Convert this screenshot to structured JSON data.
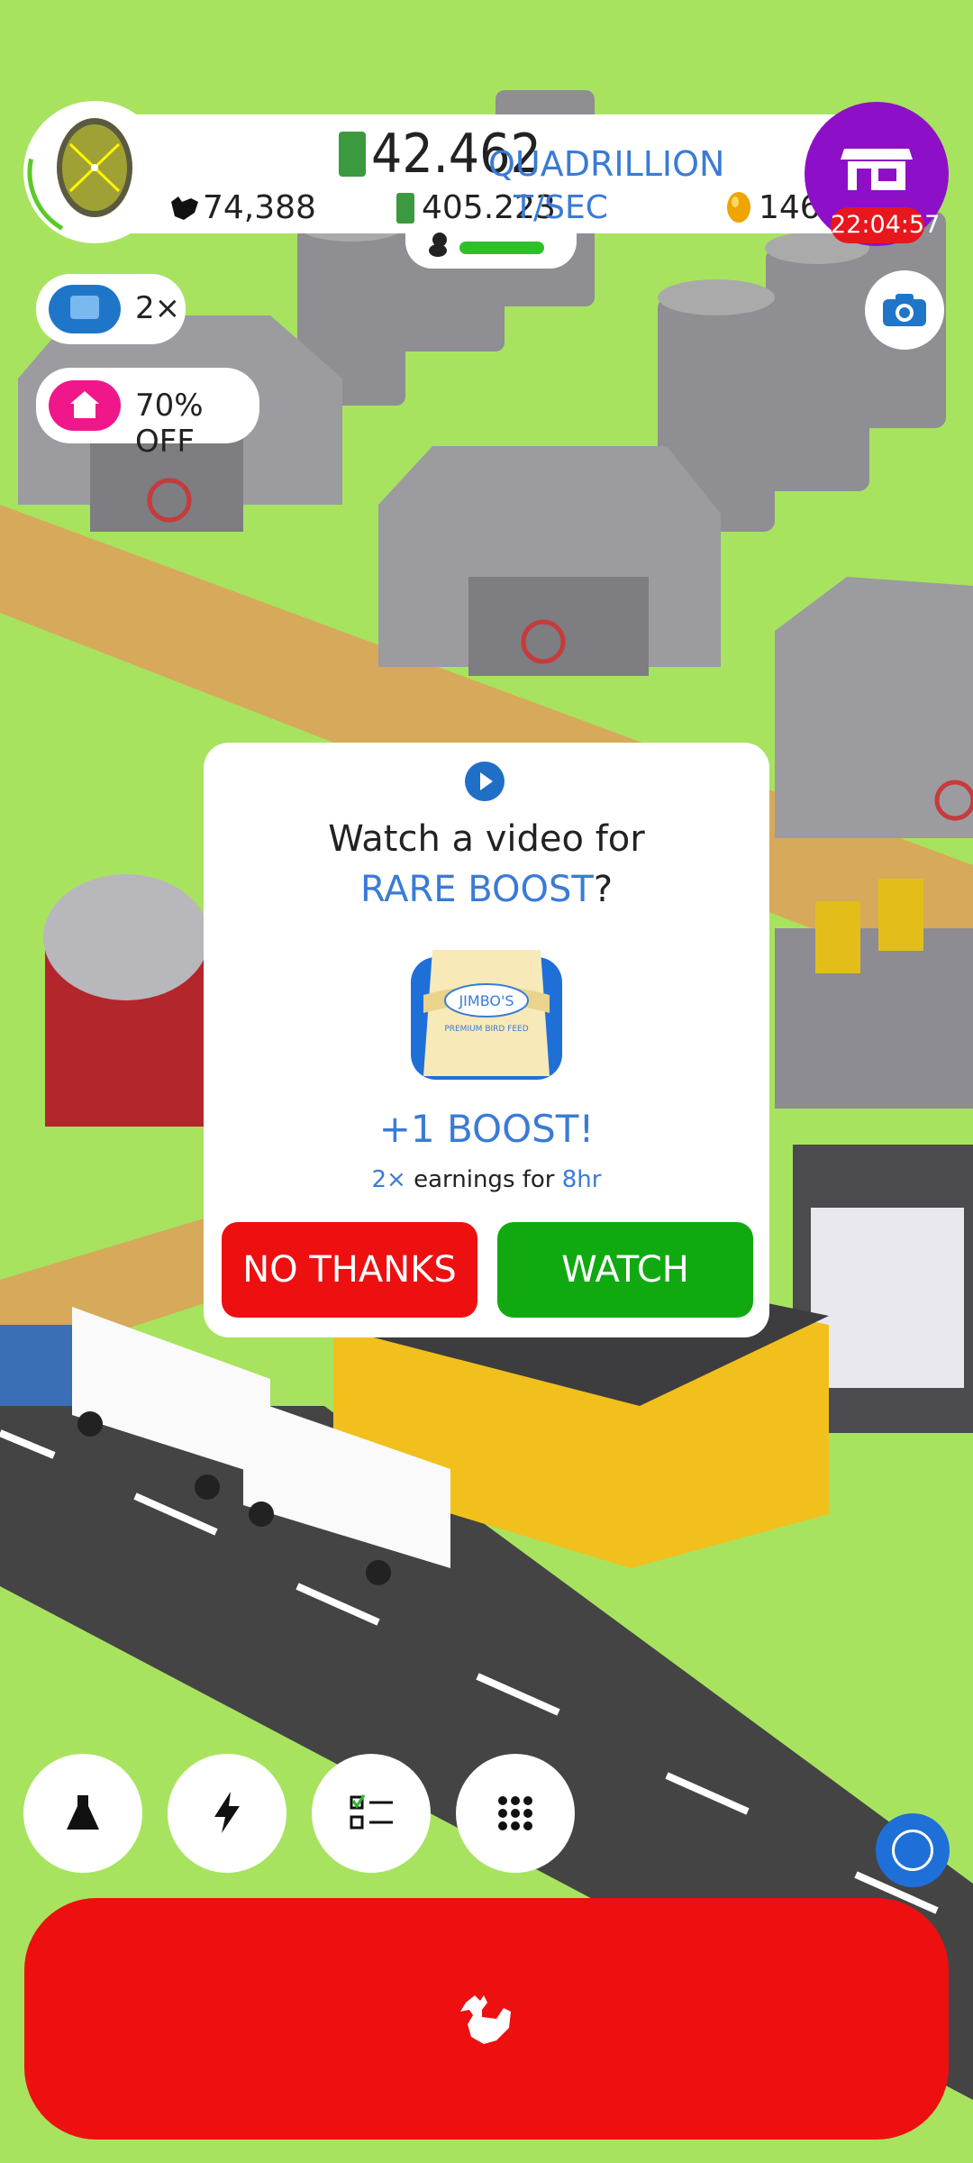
{
  "hud": {
    "money_value": "42.462",
    "money_unit": "QUADRILLION",
    "rate_value": "405.223",
    "rate_unit": "T/SEC",
    "chicken_count": "74,388",
    "golden_egg_count": "146",
    "shop_timer": "22:04:57"
  },
  "side_badges": {
    "video_multiplier": "2×",
    "discount": "70% OFF"
  },
  "dialog": {
    "title_line1": "Watch a video for",
    "title_line2_highlight": "RARE BOOST",
    "title_line2_suffix": "?",
    "product_brand": "JIMBO'S",
    "product_subtitle": "PREMIUM BIRD FEED",
    "boost_text": "+1 BOOST!",
    "multiplier": "2×",
    "earnings_text": "earnings for",
    "duration": "8hr",
    "no_thanks_label": "NO THANKS",
    "watch_label": "WATCH"
  },
  "colors": {
    "grass": "#a8e35f",
    "accent_blue": "#3a7bd5",
    "shop_purple": "#8d10c8",
    "danger_red": "#ee0f10",
    "watch_green": "#10aa10"
  },
  "icons": {
    "egg": "egg-icon",
    "shop": "shop-icon",
    "camera": "camera-icon",
    "video": "tv-icon",
    "home": "home-icon",
    "research": "flask-icon",
    "boost": "lightning-icon",
    "missions": "checklist-icon",
    "menu": "grid-icon",
    "hatch": "chicken-icon"
  }
}
